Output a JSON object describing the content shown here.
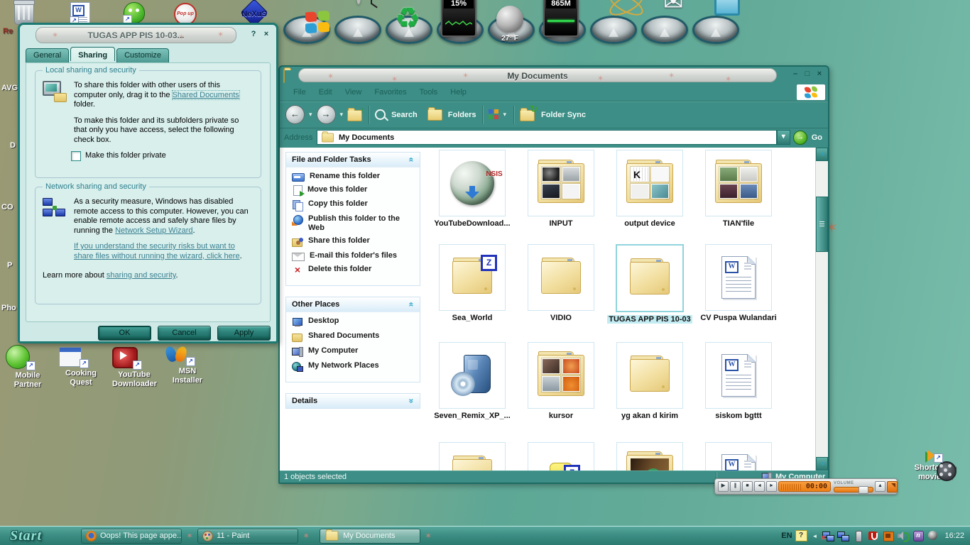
{
  "glyphs": {
    "question": "?",
    "close": "×",
    "minimize": "–",
    "maximize": "□",
    "star": "✶",
    "collapse": "«",
    "expand": "»",
    "back": "←",
    "forward": "→",
    "up": "↑",
    "caret": "▾",
    "go": "→",
    "sync": "↻",
    "shortcut": "↗",
    "delete": "×",
    "recycle": "♻",
    "mail": "✉",
    "play": "▶",
    "pause": "∥",
    "stop": "■",
    "prev": "◄",
    "next": "►",
    "eject": "▲",
    "tray_collapse": "◄",
    "red_x": "×",
    "w": "W",
    "z": "Z",
    "k": "K",
    "nsis": "NSIS",
    "n": "n"
  },
  "dock": {
    "cpu": "15%",
    "temp": "27º F",
    "ram": "865M"
  },
  "desktop_icons": {
    "partial_left": [
      "Re",
      "AVG",
      "D",
      "CO",
      "P",
      "Pho"
    ],
    "popup": "Pop up",
    "nexus": "NeXuS",
    "shortcuts": [
      "Mobile Partner",
      "Cooking Quest",
      "YouTube Downloader",
      "MSN Installer"
    ],
    "moviemk": "Shortcut to moviemk"
  },
  "dialog": {
    "title": "TUGAS APP PIS 10-03...",
    "tabs": [
      "General",
      "Sharing",
      "Customize"
    ],
    "local": {
      "caption": "Local sharing and security",
      "p1a": "To share this folder with other users of this computer only, drag it to the ",
      "p1_link": "Shared Documents",
      "p1b": " folder.",
      "p2": "To make this folder and its subfolders private so that only you have access, select the following check box.",
      "checkbox": "Make this folder private"
    },
    "network": {
      "caption": "Network sharing and security",
      "p1a": "As a security measure, Windows has disabled remote access to this computer. However, you can enable remote access and safely share files by running the ",
      "p1_link": "Network Setup Wizard",
      "p1b": ".",
      "p2_link": "If you understand the security risks but want to share files without running the wizard, click here",
      "p2b": "."
    },
    "learn_a": "Learn more about ",
    "learn_link": "sharing and security",
    "learn_b": ".",
    "ok": "OK",
    "cancel": "Cancel",
    "apply": "Apply"
  },
  "explorer": {
    "title": "My Documents",
    "menu": [
      "File",
      "Edit",
      "View",
      "Favorites",
      "Tools",
      "Help"
    ],
    "toolbar": {
      "search": "Search",
      "folders": "Folders",
      "sync": "Folder Sync"
    },
    "address_label": "Address",
    "address_value": "My Documents",
    "go": "Go",
    "panel": {
      "s1_title": "File and Folder Tasks",
      "s1_items": [
        "Rename this folder",
        "Move this folder",
        "Copy this folder",
        "Publish this folder to the Web",
        "Share this folder",
        "E-mail this folder's files",
        "Delete this folder"
      ],
      "s2_title": "Other Places",
      "s2_items": [
        "Desktop",
        "Shared Documents",
        "My Computer",
        "My Network Places"
      ],
      "s3_title": "Details"
    },
    "files": [
      "YouTubeDownload...",
      "INPUT",
      "output device",
      "TIAN'file",
      "Sea_World",
      "VIDIO",
      "TUGAS APP PIS 10-03",
      "CV Puspa Wulandari",
      "Seven_Remix_XP_...",
      "kursor",
      "yg akan d kirim",
      "siskom bgttt"
    ],
    "status_left": "1 objects selected",
    "status_right": "My Computer"
  },
  "player": {
    "time": "00:00",
    "volume": "VOLUME"
  },
  "taskbar": {
    "start": "Start",
    "tasks": [
      "Oops! This page appe...",
      "11 - Paint",
      "My Documents"
    ],
    "lang": "EN",
    "clock": "16:22"
  },
  "colors": {
    "accent_teal": "#3d8e86",
    "selection": "#c2ecf2",
    "orange": "#f08020"
  }
}
